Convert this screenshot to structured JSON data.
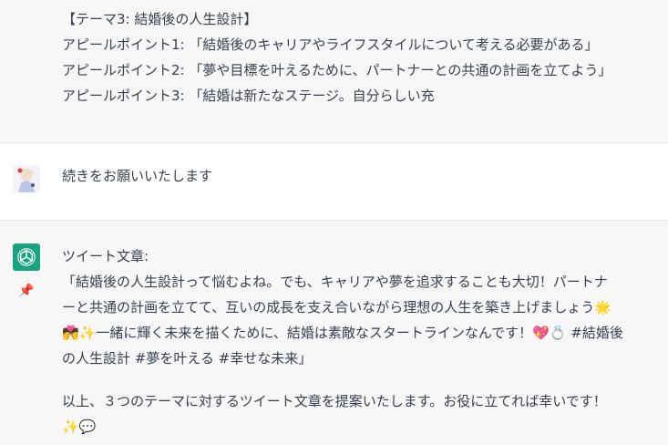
{
  "chat": {
    "top_message": {
      "lines": [
        "【テーマ3: 結婚後の人生設計】",
        "アピールポイント1: 「結婚後のキャリアやライフスタイルについて考える必要がある」",
        "アピールポイント2: 「夢や目標を叶えるために、パートナーとの共通の計画を立てよう」",
        "アピールポイント3: 「結婚は新たなステージ。自分らしい充"
      ]
    },
    "user_message": {
      "text": "続きをお願いいたします",
      "avatar_icon": "anime-character-avatar-icon"
    },
    "assistant_message": {
      "avatar_icon": "chatgpt-logo-icon",
      "pin_icon": "pushpin-icon",
      "accent": "#19a37f",
      "lines": [
        "ツイート文章:",
        "「結婚後の人生設計って悩むよね。でも、キャリアや夢を追求することも大切！パートナ",
        "ーと共通の計画を立てて、互いの成長を支え合いながら理想の人生を築き上げましょう🌟",
        "💏✨一緒に輝く未来を描くために、結婚は素敵なスタートラインなんです！💖💍 #結婚後",
        "の人生設計 #夢を叶える #幸せな未来」"
      ],
      "closing_lines": [
        "以上、３つのテーマに対するツイート文章を提案いたします。お役に立てれば幸いです！",
        "✨💬"
      ]
    }
  }
}
